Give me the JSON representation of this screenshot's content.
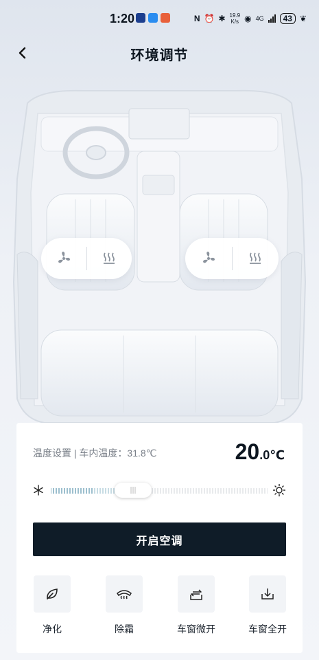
{
  "status_bar": {
    "time": "1:20",
    "network_speed_value": "19.9",
    "network_speed_unit": "K/s",
    "network_type": "4G",
    "battery": "43"
  },
  "header": {
    "title": "环境调节"
  },
  "seat_controls": {
    "left": [
      "fan-icon",
      "seat-heat-icon"
    ],
    "right": [
      "fan-icon",
      "seat-heat-icon"
    ]
  },
  "climate": {
    "temp_label": "温度设置 | 车内温度：31.8℃",
    "temp_integer": "20",
    "temp_unit": ".0℃",
    "slider_position": 0.38,
    "cool_color": "#3a7f9c",
    "ac_button_label": "开启空调"
  },
  "actions": [
    {
      "label": "净化",
      "icon": "leaf-icon"
    },
    {
      "label": "除霜",
      "icon": "defrost-icon"
    },
    {
      "label": "车窗微开",
      "icon": "window-vent-icon"
    },
    {
      "label": "车窗全开",
      "icon": "window-open-icon"
    }
  ],
  "colors": {
    "primary_button": "#0f1c28",
    "background": "#eef1f6"
  }
}
